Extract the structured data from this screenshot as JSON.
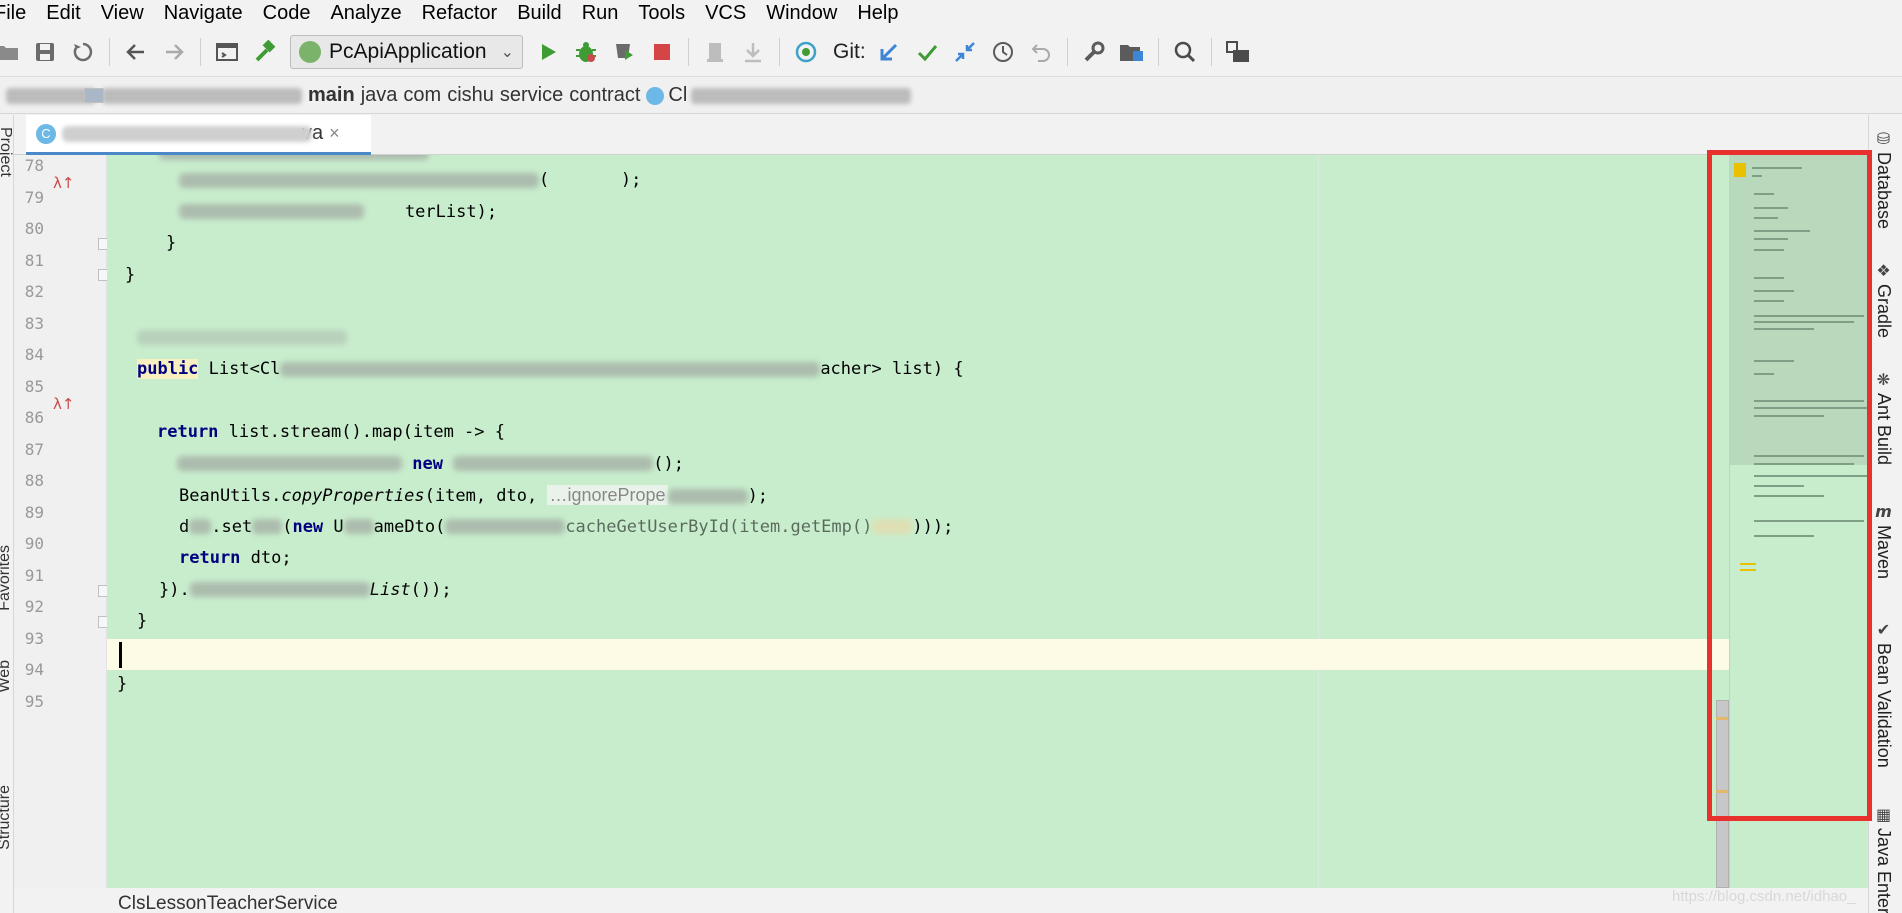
{
  "menu": [
    "File",
    "Edit",
    "View",
    "Navigate",
    "Code",
    "Analyze",
    "Refactor",
    "Build",
    "Run",
    "Tools",
    "VCS",
    "Window",
    "Help"
  ],
  "toolbar": {
    "run_config": "PcApiApplication",
    "git_label": "Git:"
  },
  "breadcrumb": [
    "main",
    "java",
    "com",
    "cishu",
    "service",
    "contract",
    "Cl"
  ],
  "tab": {
    "suffix": "va",
    "icon_letter": "C"
  },
  "left_tools": [
    "Project",
    "Favorites",
    "Web",
    "Structure"
  ],
  "line_numbers": [
    "78",
    "79",
    "80",
    "81",
    "82",
    "83",
    "84",
    "85",
    "86",
    "87",
    "88",
    "89",
    "90",
    "91",
    "92",
    "93",
    "94",
    "95"
  ],
  "code": {
    "l78_end": "(       );",
    "l79_mid": "    terList);",
    "l80": "    }",
    "l81": "}",
    "l84_kw": "public",
    "l84_type": " List<Cl",
    "l84_end": "acher> list) {",
    "l86_kw": "return",
    "l86_rest": " list.stream().map(item -> {",
    "l87_new": "new",
    "l87_end": "();",
    "l88_start": "BeanUtils.",
    "l88_method": "copyProperties",
    "l88_args": "(item, dto, ",
    "l88_hint": "…ignorePrope",
    "l88_end": ");",
    "l89_start": "d",
    "l89_mid": ".set",
    "l89_new": "new",
    "l89_rest": " U",
    "l89_mid2": "ameDto(",
    "l89_mid3": "cacheGetUserById(item.getEmp()",
    "l89_end": ")));",
    "l90_kw": "return",
    "l90_rest": " dto;",
    "l91_start": "}).",
    "l91_method": "List",
    "l91_end": "());",
    "l92": "}",
    "l94": "}"
  },
  "editor_footer": "ClsLessonTeacherService",
  "right_tools": [
    "Database",
    "Gradle",
    "Ant Build",
    "Maven",
    "Bean Validation",
    "Java Enter"
  ],
  "watermark": "https://blog.csdn.net/idhao_"
}
